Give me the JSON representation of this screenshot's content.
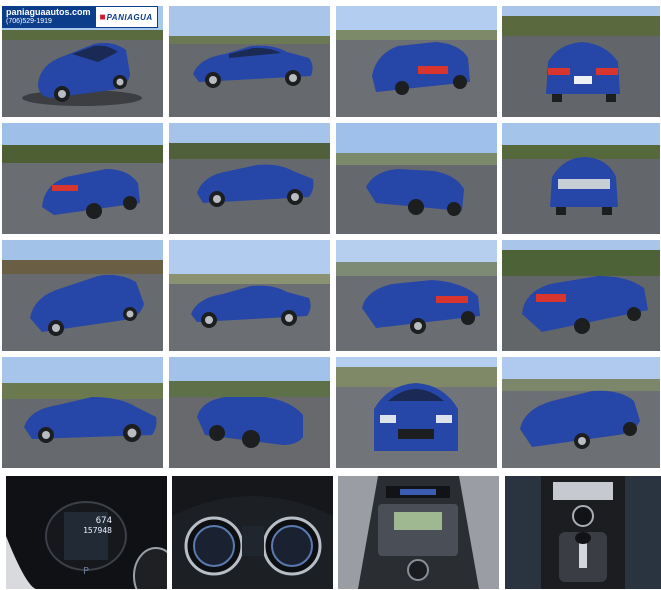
{
  "watermark": {
    "site": "paniaguaautos.com",
    "phone": "(706)529-1919",
    "logo_text": "PANIAGUA"
  },
  "odometer": {
    "trip": "674",
    "total": "157948"
  },
  "colors": {
    "car": "#2646a8",
    "sky": "#aac8ec",
    "lot": "#5f6266",
    "grass": "#8aa25a",
    "trees": "#5b6b40"
  },
  "gallery": {
    "photos": [
      {
        "view": "front-left-three-quarter"
      },
      {
        "view": "left-side"
      },
      {
        "view": "rear-left-three-quarter"
      },
      {
        "view": "rear"
      },
      {
        "view": "rear-left-three-quarter"
      },
      {
        "view": "left-side"
      },
      {
        "view": "front-right-three-quarter"
      },
      {
        "view": "front"
      },
      {
        "view": "front-left-three-quarter"
      },
      {
        "view": "left-side"
      },
      {
        "view": "rear-right-three-quarter"
      },
      {
        "view": "rear-left-three-quarter"
      },
      {
        "view": "left-side"
      },
      {
        "view": "front-right-three-quarter"
      },
      {
        "view": "front"
      },
      {
        "view": "front-right-three-quarter"
      },
      {
        "view": "interior-odometer"
      },
      {
        "view": "interior-gauges"
      },
      {
        "view": "interior-center-console"
      },
      {
        "view": "interior-gear-shifter"
      }
    ]
  }
}
